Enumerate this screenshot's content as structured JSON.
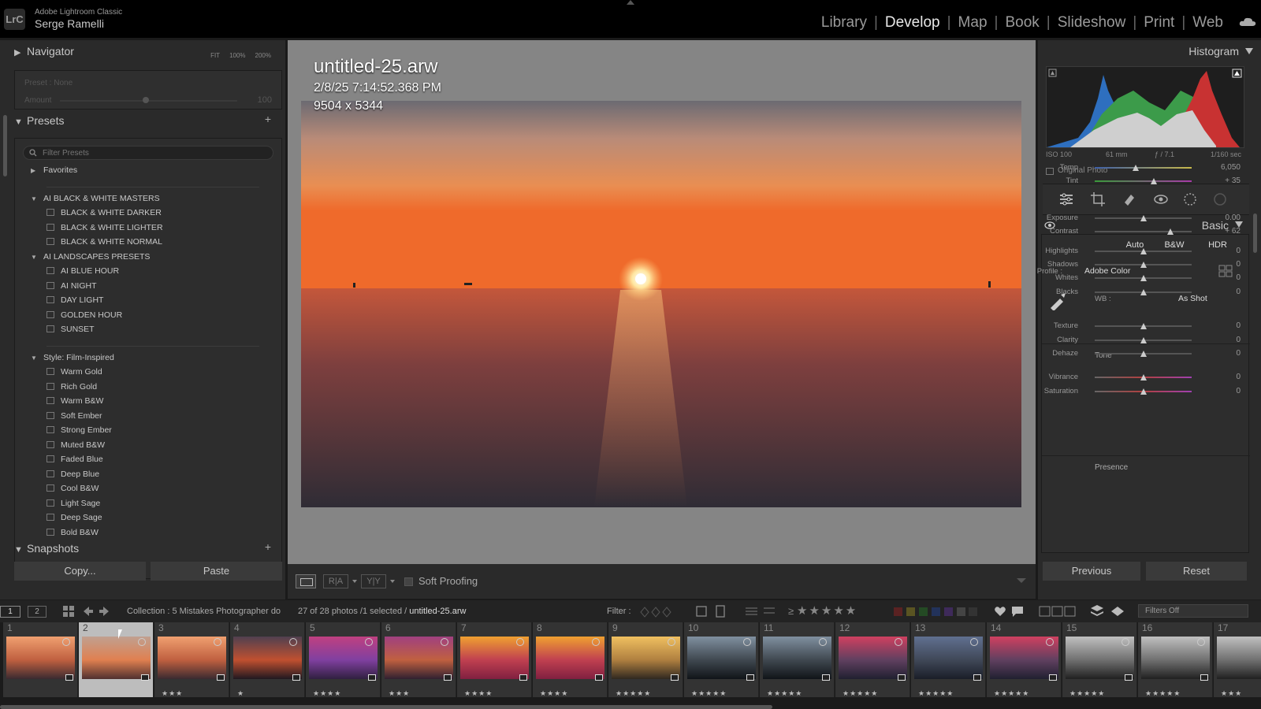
{
  "app": {
    "name": "Adobe Lightroom Classic",
    "user": "Serge Ramelli",
    "logo": "LrC"
  },
  "modules": [
    "Library",
    "Develop",
    "Map",
    "Book",
    "Slideshow",
    "Print",
    "Web"
  ],
  "active_module": "Develop",
  "navigator": {
    "title": "Navigator",
    "zoom": [
      "FIT",
      "100%",
      "200%"
    ],
    "preset_label": "Preset : None",
    "amount_label": "Amount",
    "amount_value": "100"
  },
  "presets": {
    "title": "Presets",
    "search_placeholder": "Filter Presets",
    "groups": [
      {
        "name": "Favorites",
        "expanded": false,
        "items": []
      },
      {
        "name": "AI BLACK & WHITE MASTERS",
        "expanded": true,
        "items": [
          "BLACK & WHITE DARKER",
          "BLACK & WHITE LIGHTER",
          "BLACK & WHITE NORMAL"
        ]
      },
      {
        "name": "AI LANDSCAPES PRESETS",
        "expanded": true,
        "items": [
          "AI BLUE HOUR",
          "AI NIGHT",
          "DAY LIGHT",
          "GOLDEN HOUR",
          "SUNSET"
        ]
      },
      {
        "name": "Style: Film-Inspired",
        "expanded": true,
        "items": [
          "Warm Gold",
          "Rich Gold",
          "Warm B&W",
          "Soft Ember",
          "Strong Ember",
          "Muted B&W",
          "Faded Blue",
          "Deep Blue",
          "Cool B&W",
          "Light Sage",
          "Deep Sage",
          "Bold B&W"
        ]
      }
    ]
  },
  "snapshots": {
    "title": "Snapshots"
  },
  "left_buttons": {
    "copy": "Copy...",
    "paste": "Paste"
  },
  "image": {
    "filename": "untitled-25.arw",
    "datetime": "2/8/25 7:14:52.368 PM",
    "dimensions": "9504 x 5344"
  },
  "toolbar": {
    "ra": "R|A",
    "yy": "Y|Y",
    "soft_proofing": "Soft Proofing"
  },
  "histogram": {
    "title": "Histogram",
    "iso": "ISO 100",
    "focal": "61 mm",
    "aperture": "ƒ / 7.1",
    "shutter": "1/160 sec",
    "original_photo": "Original Photo"
  },
  "basic": {
    "title": "Basic",
    "treatments": [
      "Auto",
      "B&W",
      "HDR"
    ],
    "profile_label": "Profile :",
    "profile_value": "Adobe Color",
    "wb_label": "WB :",
    "wb_value": "As Shot",
    "tone_label": "Tone",
    "presence_label": "Presence",
    "sliders": [
      {
        "name": "Temp",
        "value": "6,050",
        "pos": 0.42
      },
      {
        "name": "Tint",
        "value": "+ 35",
        "pos": 0.61
      },
      {
        "name": "Exposure",
        "value": "0.00",
        "pos": 0.5
      },
      {
        "name": "Contrast",
        "value": "+ 62",
        "pos": 0.78
      },
      {
        "name": "Highlights",
        "value": "0",
        "pos": 0.5
      },
      {
        "name": "Shadows",
        "value": "0",
        "pos": 0.5
      },
      {
        "name": "Whites",
        "value": "0",
        "pos": 0.5
      },
      {
        "name": "Blacks",
        "value": "0",
        "pos": 0.5
      },
      {
        "name": "Texture",
        "value": "0",
        "pos": 0.5
      },
      {
        "name": "Clarity",
        "value": "0",
        "pos": 0.5
      },
      {
        "name": "Dehaze",
        "value": "0",
        "pos": 0.5
      },
      {
        "name": "Vibrance",
        "value": "0",
        "pos": 0.5
      },
      {
        "name": "Saturation",
        "value": "0",
        "pos": 0.5
      }
    ]
  },
  "right_buttons": {
    "previous": "Previous",
    "reset": "Reset"
  },
  "filmstrip_bar": {
    "page1": "1",
    "page2": "2",
    "collection": "Collection : 5 Mistakes Photographer do",
    "count": "27 of 28 photos /1 selected /",
    "selected_file": "untitled-25.arw",
    "filter_label": "Filter :",
    "filter_value": "Filters Off",
    "rating_op": "≥",
    "stars": "★★★★★"
  },
  "filmstrip": [
    {
      "num": "1",
      "stars": "",
      "scene": "pier",
      "selected": false
    },
    {
      "num": "2",
      "stars": "",
      "scene": "sunset",
      "selected": true
    },
    {
      "num": "3",
      "stars": "★★★",
      "scene": "pier",
      "selected": false
    },
    {
      "num": "4",
      "stars": "★",
      "scene": "pier-dark",
      "selected": false
    },
    {
      "num": "5",
      "stars": "★★★★",
      "scene": "purple",
      "selected": false
    },
    {
      "num": "6",
      "stars": "★★★",
      "scene": "purple-pier",
      "selected": false
    },
    {
      "num": "7",
      "stars": "★★★★",
      "scene": "lavender",
      "selected": false
    },
    {
      "num": "8",
      "stars": "★★★★",
      "scene": "lavender",
      "selected": false
    },
    {
      "num": "9",
      "stars": "★★★★★",
      "scene": "lake",
      "selected": false
    },
    {
      "num": "10",
      "stars": "★★★★★",
      "scene": "lake-dark",
      "selected": false
    },
    {
      "num": "11",
      "stars": "★★★★★",
      "scene": "lake-dark",
      "selected": false
    },
    {
      "num": "12",
      "stars": "★★★★★",
      "scene": "bridge-red",
      "selected": false
    },
    {
      "num": "13",
      "stars": "★★★★★",
      "scene": "bridge-blue",
      "selected": false
    },
    {
      "num": "14",
      "stars": "★★★★★",
      "scene": "bridge-red",
      "selected": false
    },
    {
      "num": "15",
      "stars": "★★★★★",
      "scene": "bridge-bw",
      "selected": false
    },
    {
      "num": "16",
      "stars": "★★★★★",
      "scene": "bridge-bw",
      "selected": false
    },
    {
      "num": "17",
      "stars": "★★★",
      "scene": "bridge-bw",
      "selected": false
    }
  ]
}
